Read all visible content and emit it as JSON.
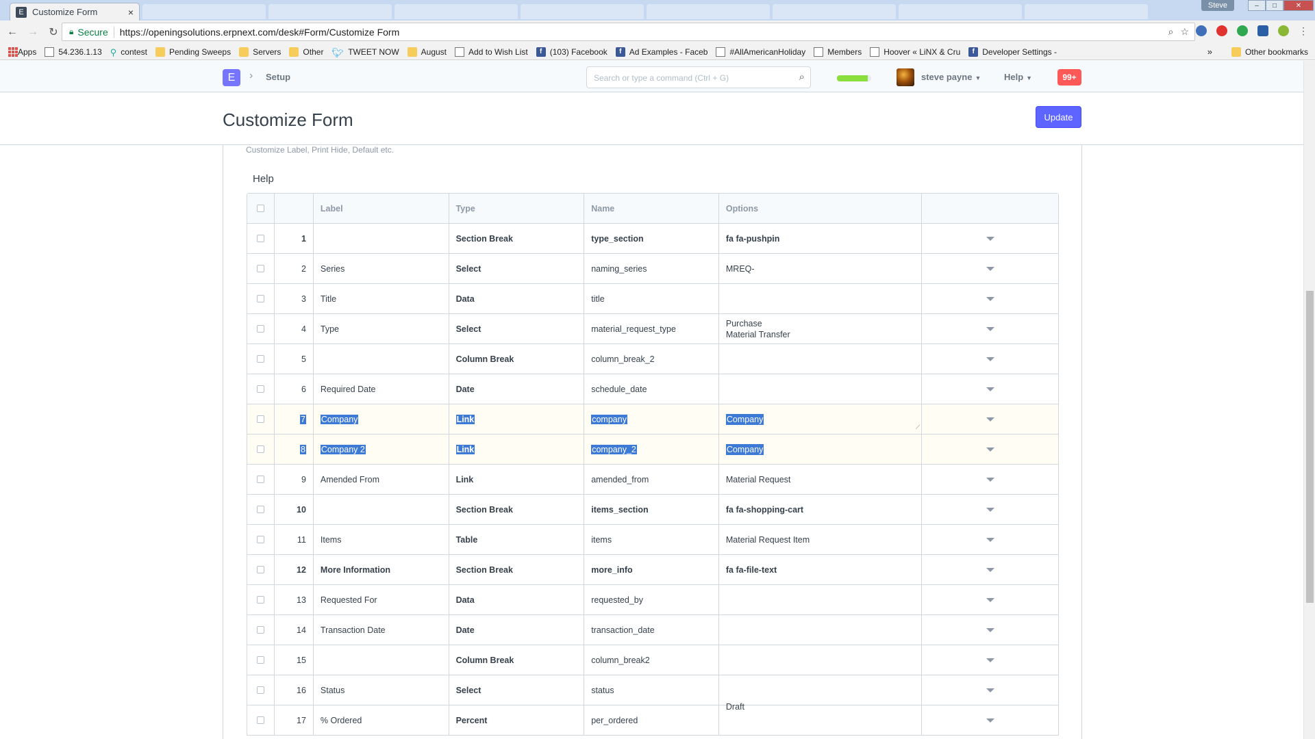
{
  "browser": {
    "tab_title": "Customize Form",
    "tab_favicon": "E",
    "tab_close": "×",
    "window_user": "Steve",
    "secure_label": "Secure",
    "url": "https://openingsolutions.erpnext.com/desk#Form/Customize Form",
    "bookmarks": [
      {
        "label": "Apps",
        "icon": "apps-grid-icon"
      },
      {
        "label": "54.236.1.13",
        "icon": "page-icon"
      },
      {
        "label": "contest",
        "icon": "pin-icon"
      },
      {
        "label": "Pending Sweeps",
        "icon": "folder-icon"
      },
      {
        "label": "Servers",
        "icon": "folder-icon"
      },
      {
        "label": "Other",
        "icon": "folder-icon"
      },
      {
        "label": "TWEET NOW",
        "icon": "twitter-icon"
      },
      {
        "label": "August",
        "icon": "folder-icon"
      },
      {
        "label": "Add to Wish List",
        "icon": "page-icon"
      },
      {
        "label": "(103) Facebook",
        "icon": "facebook-icon"
      },
      {
        "label": "Ad Examples - Faceb",
        "icon": "facebook-icon"
      },
      {
        "label": "#AllAmericanHoliday",
        "icon": "link-icon"
      },
      {
        "label": "Members",
        "icon": "page-icon"
      },
      {
        "label": "Hoover « LiNX & Cru",
        "icon": "link-icon"
      },
      {
        "label": "Developer Settings -",
        "icon": "facebook-icon"
      }
    ],
    "bookmarks_more": "»",
    "other_bookmarks": "Other bookmarks"
  },
  "navbar": {
    "logo_letter": "E",
    "breadcrumb": "Setup",
    "search_placeholder": "Search or type a command (Ctrl + G)",
    "progress_fraction": 0.9,
    "user_name": "steve payne",
    "help_label": "Help",
    "notifications": "99+"
  },
  "page": {
    "title": "Customize Form",
    "update_button": "Update",
    "description": "Customize Label, Print Hide, Default etc.",
    "help_label": "Help"
  },
  "grid": {
    "headers": {
      "label": "Label",
      "type": "Type",
      "name": "Name",
      "options": "Options"
    },
    "rows": [
      {
        "idx": "1",
        "label": "",
        "type": "Section Break",
        "name": "type_section",
        "options": "fa fa-pushpin",
        "bold": true,
        "selected": false
      },
      {
        "idx": "2",
        "label": "Series",
        "type": "Select",
        "name": "naming_series",
        "options": "MREQ-",
        "bold": false,
        "selected": false
      },
      {
        "idx": "3",
        "label": "Title",
        "type": "Data",
        "name": "title",
        "options": "",
        "bold": false,
        "selected": false
      },
      {
        "idx": "4",
        "label": "Type",
        "type": "Select",
        "name": "material_request_type",
        "options": "Purchase\nMaterial Transfer",
        "bold": false,
        "selected": false
      },
      {
        "idx": "5",
        "label": "",
        "type": "Column Break",
        "name": "column_break_2",
        "options": "",
        "bold": false,
        "selected": false
      },
      {
        "idx": "6",
        "label": "Required Date",
        "type": "Date",
        "name": "schedule_date",
        "options": "",
        "bold": false,
        "selected": false
      },
      {
        "idx": "7",
        "label": "Company",
        "type": "Link",
        "name": "company",
        "options": "Company",
        "bold": false,
        "selected": true,
        "editing": true
      },
      {
        "idx": "8",
        "label": "Company 2",
        "type": "Link",
        "name": "company_2",
        "options": "Company",
        "bold": false,
        "selected": true
      },
      {
        "idx": "9",
        "label": "Amended From",
        "type": "Link",
        "name": "amended_from",
        "options": "Material Request",
        "bold": false,
        "selected": false
      },
      {
        "idx": "10",
        "label": "",
        "type": "Section Break",
        "name": "items_section",
        "options": "fa fa-shopping-cart",
        "bold": true,
        "selected": false
      },
      {
        "idx": "11",
        "label": "Items",
        "type": "Table",
        "name": "items",
        "options": "Material Request Item",
        "bold": false,
        "selected": false
      },
      {
        "idx": "12",
        "label": "More Information",
        "type": "Section Break",
        "name": "more_info",
        "options": "fa fa-file-text",
        "bold": true,
        "selected": false
      },
      {
        "idx": "13",
        "label": "Requested For",
        "type": "Data",
        "name": "requested_by",
        "options": "",
        "bold": false,
        "selected": false
      },
      {
        "idx": "14",
        "label": "Transaction Date",
        "type": "Date",
        "name": "transaction_date",
        "options": "",
        "bold": false,
        "selected": false
      },
      {
        "idx": "15",
        "label": "",
        "type": "Column Break",
        "name": "column_break2",
        "options": "",
        "bold": false,
        "selected": false
      },
      {
        "idx": "16",
        "label": "Status",
        "type": "Select",
        "name": "status",
        "options": "\n\nDraft",
        "bold": false,
        "selected": false
      },
      {
        "idx": "17",
        "label": "% Ordered",
        "type": "Percent",
        "name": "per_ordered",
        "options": "",
        "bold": false,
        "selected": false
      }
    ]
  },
  "colors": {
    "accent": "#5e64ff",
    "selection": "#3d7ad6",
    "notification": "#ff5858",
    "progress": "#8adf3f"
  }
}
